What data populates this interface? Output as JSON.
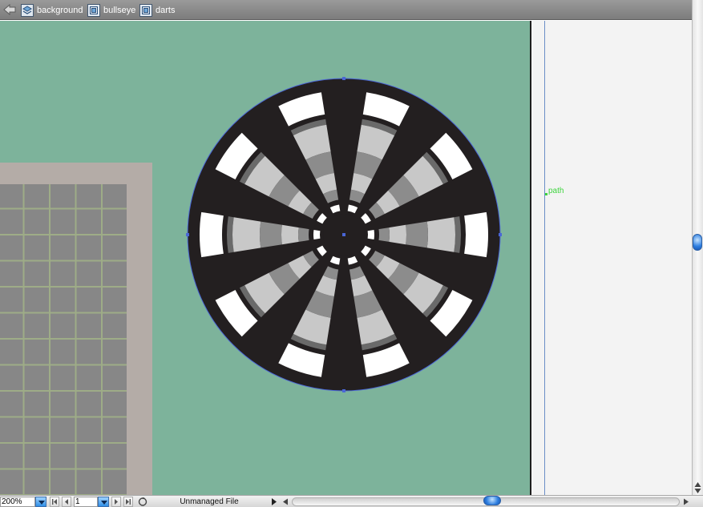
{
  "breadcrumbs": [
    {
      "label": "background",
      "icon": "layer-stack-icon"
    },
    {
      "label": "bullseye",
      "icon": "symbol-instance-icon"
    },
    {
      "label": "darts",
      "icon": "symbol-instance-icon"
    }
  ],
  "canvas": {
    "selected_object_label": "path",
    "colors": {
      "stage": "#7db39b",
      "board_dark": "#231f20",
      "board_white": "#ffffff",
      "ring_light": "#c8c8c8",
      "ring_mid": "#8c8c8c",
      "ring_dark": "#6a6a6a",
      "selection": "#4a66d6",
      "path_label": "#3ed43e"
    }
  },
  "statusbar": {
    "zoom": "200%",
    "page": "1",
    "status": "Unmanaged File"
  }
}
